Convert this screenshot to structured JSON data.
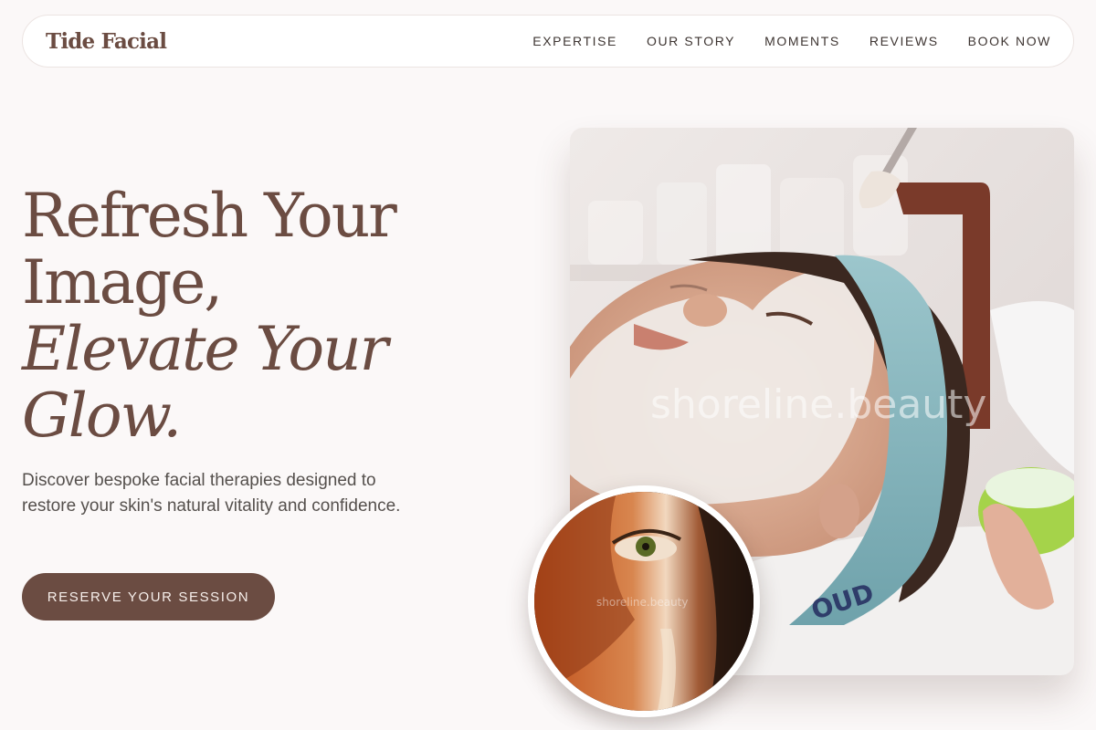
{
  "brand": {
    "name": "Tide Facial"
  },
  "nav": {
    "items": [
      {
        "label": "EXPERTISE"
      },
      {
        "label": "OUR STORY"
      },
      {
        "label": "MOMENTS"
      },
      {
        "label": "REVIEWS"
      },
      {
        "label": "BOOK NOW"
      }
    ]
  },
  "hero": {
    "title_line1": "Refresh Your",
    "title_line2": "Image,",
    "title_italic1": "Elevate Your",
    "title_italic2": "Glow.",
    "subtitle": "Discover bespoke facial therapies designed to restore your skin's natural vitality and confidence.",
    "cta_label": "RESERVE YOUR SESSION"
  },
  "images": {
    "main_watermark": "shoreline.beauty",
    "inset_watermark": "shoreline.beauty",
    "headband_text": "OUD"
  },
  "colors": {
    "accent": "#6b4c42",
    "background": "#fbf8f8"
  }
}
